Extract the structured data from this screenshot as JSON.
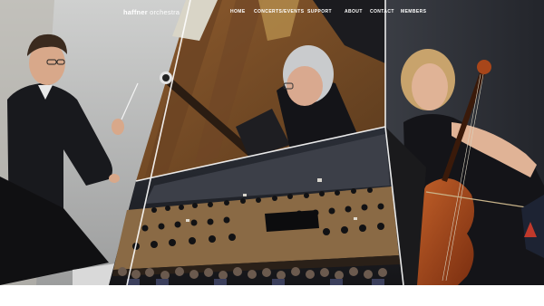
{
  "brand": {
    "bold": "haffner",
    "light": " orchestra"
  },
  "nav": {
    "items": [
      {
        "key": "home",
        "label": "HOME"
      },
      {
        "key": "concerts",
        "label": "CONCERTS/EVENTS"
      },
      {
        "key": "support",
        "label": "SUPPORT"
      },
      {
        "key": "about",
        "label": "ABOUT"
      },
      {
        "key": "contact",
        "label": "CONTACT"
      },
      {
        "key": "members",
        "label": "MEMBERS"
      }
    ]
  },
  "colors": {
    "nav_text": "#ffffff",
    "stage_floor": "#8a6a45",
    "cello_wood": "#b0531e",
    "accent_red": "#c0392b"
  }
}
